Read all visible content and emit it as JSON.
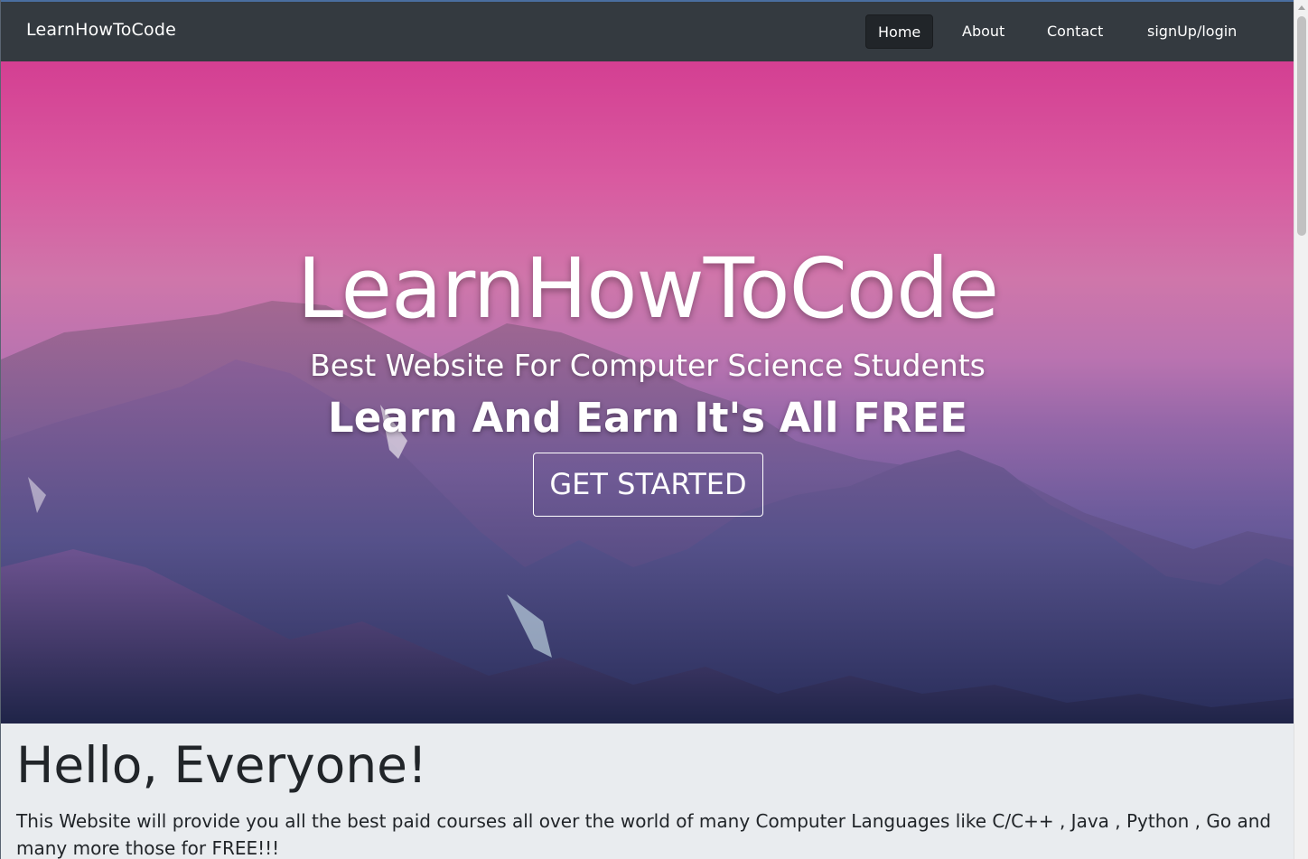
{
  "navbar": {
    "brand": "LearnHowToCode",
    "links": [
      {
        "label": "Home",
        "active": true
      },
      {
        "label": "About",
        "active": false
      },
      {
        "label": "Contact",
        "active": false
      },
      {
        "label": "signUp/login",
        "active": false
      }
    ]
  },
  "hero": {
    "title": "LearnHowToCode",
    "subtitle": "Best Website For Computer Science Students",
    "tagline": "Learn And Earn It's All FREE",
    "cta_label": "GET STARTED",
    "slide_count": 3
  },
  "jumbotron": {
    "heading": "Hello, Everyone!",
    "text": "This Website will provide you all the best paid courses all over the world of many Computer Languages like C/C++ , Java , Python , Go and many more those for FREE!!!"
  },
  "colors": {
    "navbar_bg": "#343a40",
    "active_link_bg": "#212529",
    "jumbotron_bg": "#e9ecef",
    "sky_top": "#d43f92",
    "mountain": "#3b3e74"
  }
}
